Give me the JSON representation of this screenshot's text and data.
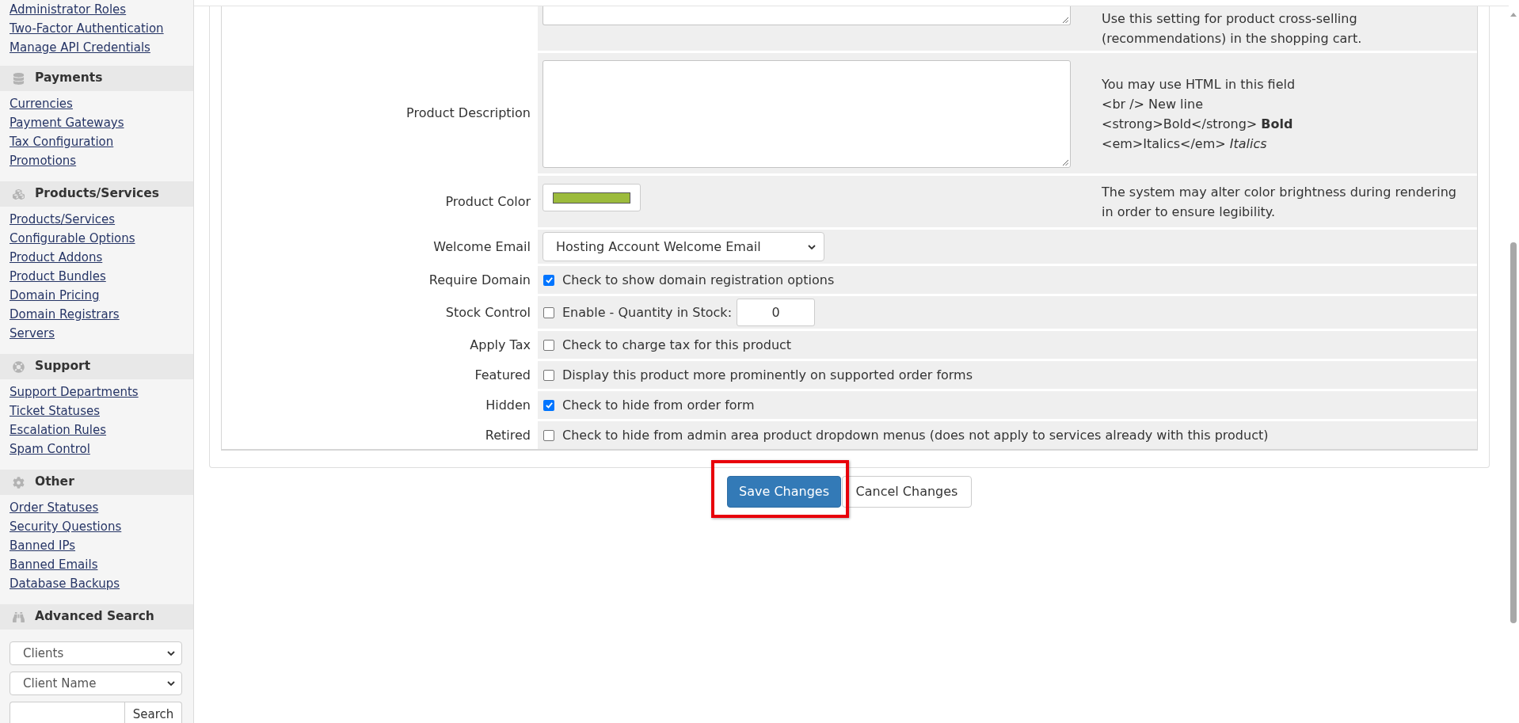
{
  "sidebar": {
    "top_links": [
      "Administrator Roles",
      "Two-Factor Authentication",
      "Manage API Credentials"
    ],
    "sections": [
      {
        "title": "Payments",
        "links": [
          "Currencies",
          "Payment Gateways",
          "Tax Configuration",
          "Promotions"
        ]
      },
      {
        "title": "Products/Services",
        "links": [
          "Products/Services",
          "Configurable Options",
          "Product Addons",
          "Product Bundles",
          "Domain Pricing",
          "Domain Registrars",
          "Servers"
        ]
      },
      {
        "title": "Support",
        "links": [
          "Support Departments",
          "Ticket Statuses",
          "Escalation Rules",
          "Spam Control"
        ]
      },
      {
        "title": "Other",
        "links": [
          "Order Statuses",
          "Security Questions",
          "Banned IPs",
          "Banned Emails",
          "Database Backups"
        ]
      }
    ],
    "advanced_search": {
      "title": "Advanced Search",
      "selects": [
        "Clients",
        "Client Name"
      ],
      "button": "Search"
    }
  },
  "form": {
    "rows": [
      {
        "kind": "textarea_partial",
        "help": [
          "Use this setting for product cross-selling",
          "(recommendations) in the shopping cart."
        ]
      },
      {
        "kind": "textarea",
        "label": "Product Description",
        "help": [
          "You may use HTML in this field",
          "<br /> New line",
          "<strong>Bold</strong> **Bold**",
          "<em>Italics</em> *Italics*"
        ]
      },
      {
        "kind": "color",
        "label": "Product Color",
        "color": "#9cbb3c",
        "help": [
          "The system may alter color brightness during rendering",
          "in order to ensure legibility."
        ]
      },
      {
        "kind": "select",
        "label": "Welcome Email",
        "value": "Hosting Account Welcome Email"
      },
      {
        "kind": "checkbox",
        "label": "Require Domain",
        "checked": true,
        "text": "Check to show domain registration options"
      },
      {
        "kind": "checkbox_quantity",
        "label": "Stock Control",
        "checked": false,
        "text": "Enable - Quantity in Stock:",
        "quantity": "0"
      },
      {
        "kind": "checkbox",
        "label": "Apply Tax",
        "checked": false,
        "text": "Check to charge tax for this product"
      },
      {
        "kind": "checkbox",
        "label": "Featured",
        "checked": false,
        "text": "Display this product more prominently on supported order forms"
      },
      {
        "kind": "checkbox",
        "label": "Hidden",
        "checked": true,
        "text": "Check to hide from order form"
      },
      {
        "kind": "checkbox",
        "label": "Retired",
        "checked": false,
        "text": "Check to hide from admin area product dropdown menus (does not apply to services already with this product)"
      }
    ]
  },
  "buttons": [
    {
      "label": "Save Changes",
      "kind": "primary",
      "highlighted": true
    },
    {
      "label": "Cancel Changes",
      "kind": "default",
      "highlighted": false
    }
  ]
}
